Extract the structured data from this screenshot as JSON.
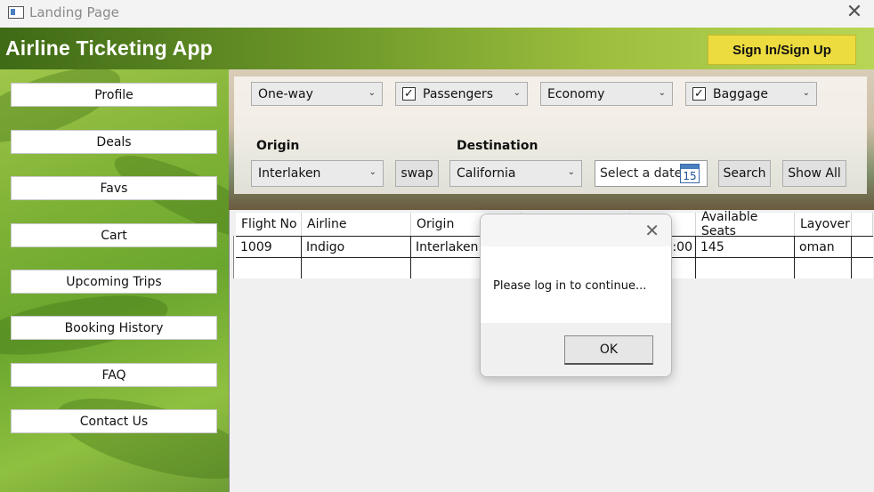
{
  "window": {
    "title": "Landing Page"
  },
  "header": {
    "app_title": "Airline Ticketing App",
    "signin_label": "Sign In/Sign Up"
  },
  "sidebar": {
    "items": [
      {
        "label": "Profile"
      },
      {
        "label": "Deals"
      },
      {
        "label": "Favs"
      },
      {
        "label": "Cart"
      },
      {
        "label": "Upcoming Trips"
      },
      {
        "label": "Booking History"
      },
      {
        "label": "FAQ"
      },
      {
        "label": "Contact Us"
      }
    ]
  },
  "search": {
    "trip_type": "One-way",
    "passengers_label": "Passengers",
    "passengers_checked": true,
    "cabin_class": "Economy",
    "baggage_label": "Baggage",
    "baggage_checked": true,
    "origin_label": "Origin",
    "origin_value": "Interlaken",
    "swap_label": "swap",
    "destination_label": "Destination",
    "destination_value": "California",
    "date_placeholder": "Select a date",
    "calendar_day": "15",
    "search_label": "Search",
    "show_all_label": "Show All"
  },
  "grid": {
    "columns": [
      "Flight No",
      "Airline",
      "Origin",
      "",
      "",
      "Available Seats",
      "Layover"
    ],
    "rows": [
      [
        "1009",
        "Indigo",
        "Interlaken",
        "",
        "0:00",
        "145",
        "oman"
      ],
      [
        "",
        "",
        "",
        "",
        "",
        "",
        ""
      ]
    ]
  },
  "dialog": {
    "message": "Please log in to continue...",
    "ok_label": "OK"
  },
  "colors": {
    "header_green": "#6f9a2a",
    "signin_yellow": "#ecdc3f",
    "sidebar_green": "#7fb236"
  },
  "icons": {
    "app": "window-icon",
    "close": "close-icon",
    "dropdown": "chevron-down-icon",
    "calendar": "calendar-icon"
  }
}
